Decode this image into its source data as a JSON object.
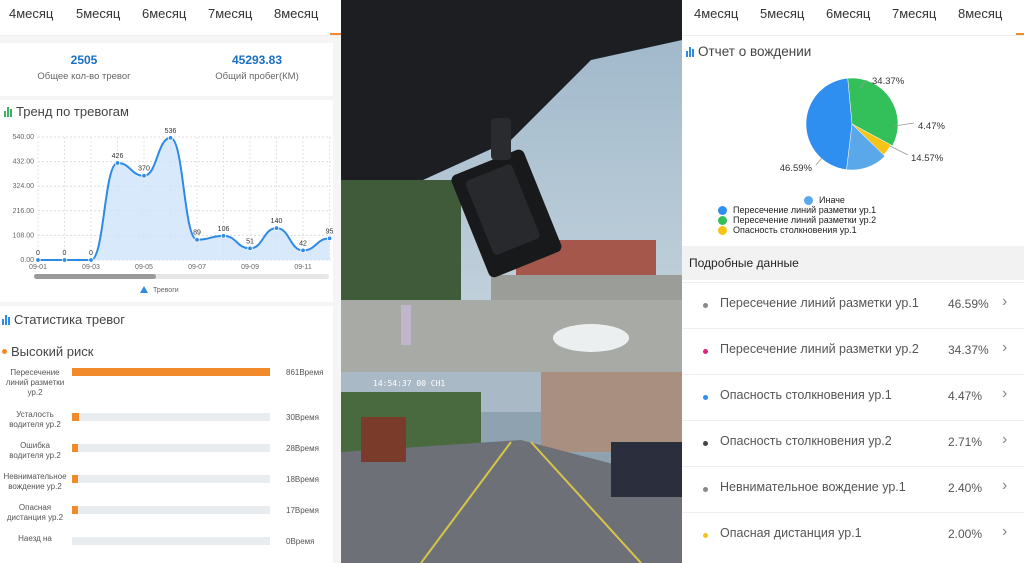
{
  "left": {
    "tabs": [
      "4месяц",
      "5месяц",
      "6месяц",
      "7месяц",
      "8месяц"
    ],
    "summary": {
      "alarms_value": "2505",
      "alarms_label": "Общее кол-во тревог",
      "mileage_value": "45293.83",
      "mileage_label": "Общий пробег(КМ)"
    },
    "trend_title": "Тренд по тревогам",
    "stats_title": "Статистика тревог",
    "high_risk_title": "Высокий риск",
    "risks": [
      {
        "name": "Пересечение линий разметки ур.2",
        "value": "861Время",
        "fraction": 1.0
      },
      {
        "name": "Усталость водителя ур.2",
        "value": "30Время",
        "fraction": 0.035
      },
      {
        "name": "Ошибка водителя ур.2",
        "value": "28Время",
        "fraction": 0.032
      },
      {
        "name": "Невнимательное вождение ур.2",
        "value": "18Время",
        "fraction": 0.021
      },
      {
        "name": "Опасная дистанция ур.2",
        "value": "17Время",
        "fraction": 0.02
      },
      {
        "name": "Наезд на",
        "value": "0Время",
        "fraction": 0.0
      }
    ]
  },
  "chart_data": {
    "type": "area",
    "x": [
      "09-01",
      "09-02",
      "09-03",
      "09-04",
      "09-05",
      "09-06",
      "09-07",
      "09-08",
      "09-09",
      "09-10",
      "09-11",
      "09-12"
    ],
    "x_tick_labels": [
      "09-01",
      "09-03",
      "09-05",
      "09-07",
      "09-09",
      "09-11"
    ],
    "series": [
      {
        "name": "Тревоги",
        "values": [
          0,
          0,
          0,
          426,
          370,
          536,
          89,
          106,
          51,
          140,
          42,
          95
        ]
      }
    ],
    "y_ticks": [
      "0.00",
      "108.00",
      "216.00",
      "324.00",
      "432.00",
      "540.00"
    ],
    "ylim": [
      0,
      540
    ],
    "grid": true,
    "legend": "bottom",
    "colors": {
      "line": "#2d8ae5",
      "fill": "#cfe3fb"
    }
  },
  "middle": {
    "timestamp": "14:54:37 00 CH1"
  },
  "right": {
    "tabs": [
      "4месяц",
      "5месяц",
      "6месяц",
      "7месяц",
      "8месяц"
    ],
    "report_title": "Отчет о вождении",
    "pie": {
      "slices": [
        {
          "label": "Иначе",
          "value": 14.57,
          "color": "#5aa7ea"
        },
        {
          "label": "Пересечение линий разметки ур.1",
          "value": 46.59,
          "color": "#2f8ff0"
        },
        {
          "label": "Пересечение линий разметки ур.2",
          "value": 34.37,
          "color": "#33c05a"
        },
        {
          "label": "Опасность столкновения ур.1",
          "value": 4.47,
          "color": "#f6c416"
        }
      ],
      "pct_labels": [
        "34.37%",
        "4.47%",
        "14.57%",
        "46.59%"
      ]
    },
    "details_title": "Подробные данные",
    "details": [
      {
        "name": "Пересечение линий разметки ур.1",
        "pct": "46.59%",
        "color": "#888888"
      },
      {
        "name": "Пересечение линий разметки ур.2",
        "pct": "34.37%",
        "color": "#e2217f"
      },
      {
        "name": "Опасность столкновения ур.1",
        "pct": "4.47%",
        "color": "#2f8ff0"
      },
      {
        "name": "Опасность столкновения ур.2",
        "pct": "2.71%",
        "color": "#444444"
      },
      {
        "name": "Невнимательное вождение ур.1",
        "pct": "2.40%",
        "color": "#888888"
      },
      {
        "name": "Опасная дистанция ур.1",
        "pct": "2.00%",
        "color": "#f6c416"
      }
    ]
  }
}
